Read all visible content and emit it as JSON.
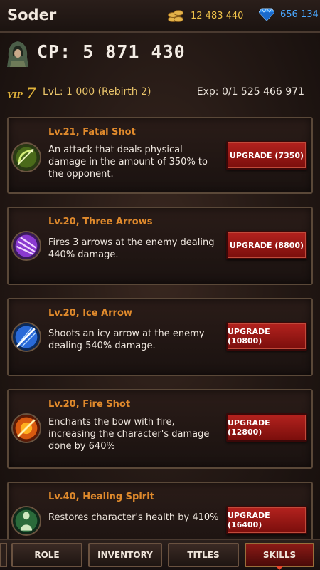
{
  "header": {
    "title": "Soder",
    "gold": "12 483 440",
    "gems": "656 134",
    "colors": {
      "gold": "#f0c34a",
      "gems": "#4aa8ff"
    }
  },
  "player": {
    "cp": "CP: 5 871 430",
    "vip_prefix": "VIP",
    "vip_level": "7",
    "level": "LvL: 1 000 (Rebirth 2)",
    "exp": "Exp: 0/1 525 466 971"
  },
  "skills": [
    {
      "name": "Lv.21, Fatal Shot",
      "desc": "An attack that deals physical damage in the amount of 350% to the opponent.",
      "button": "UPGRADE (7350)",
      "icon": "bow-icon"
    },
    {
      "name": "Lv.20, Three Arrows",
      "desc": "Fires 3 arrows at the enemy dealing 440% damage.",
      "button": "UPGRADE (8800)",
      "icon": "triple-arrow-icon"
    },
    {
      "name": "Lv.20, Ice Arrow",
      "desc": "Shoots an icy arrow at the enemy dealing 540% damage.",
      "button": "UPGRADE (10800)",
      "icon": "ice-arrow-icon"
    },
    {
      "name": "Lv.20, Fire Shot",
      "desc": "Enchants the bow with fire, increasing the character's damage done by 640%",
      "button": "UPGRADE (12800)",
      "icon": "fire-shot-icon"
    },
    {
      "name": "Lv.40, Healing Spirit",
      "desc": "Restores character's health by 410%",
      "button": "UPGRADE (16400)",
      "icon": "healing-spirit-icon"
    }
  ],
  "nav": {
    "role": "ROLE",
    "inventory": "INVENTORY",
    "titles": "TITLES",
    "skills": "SKILLS",
    "active": "skills"
  }
}
